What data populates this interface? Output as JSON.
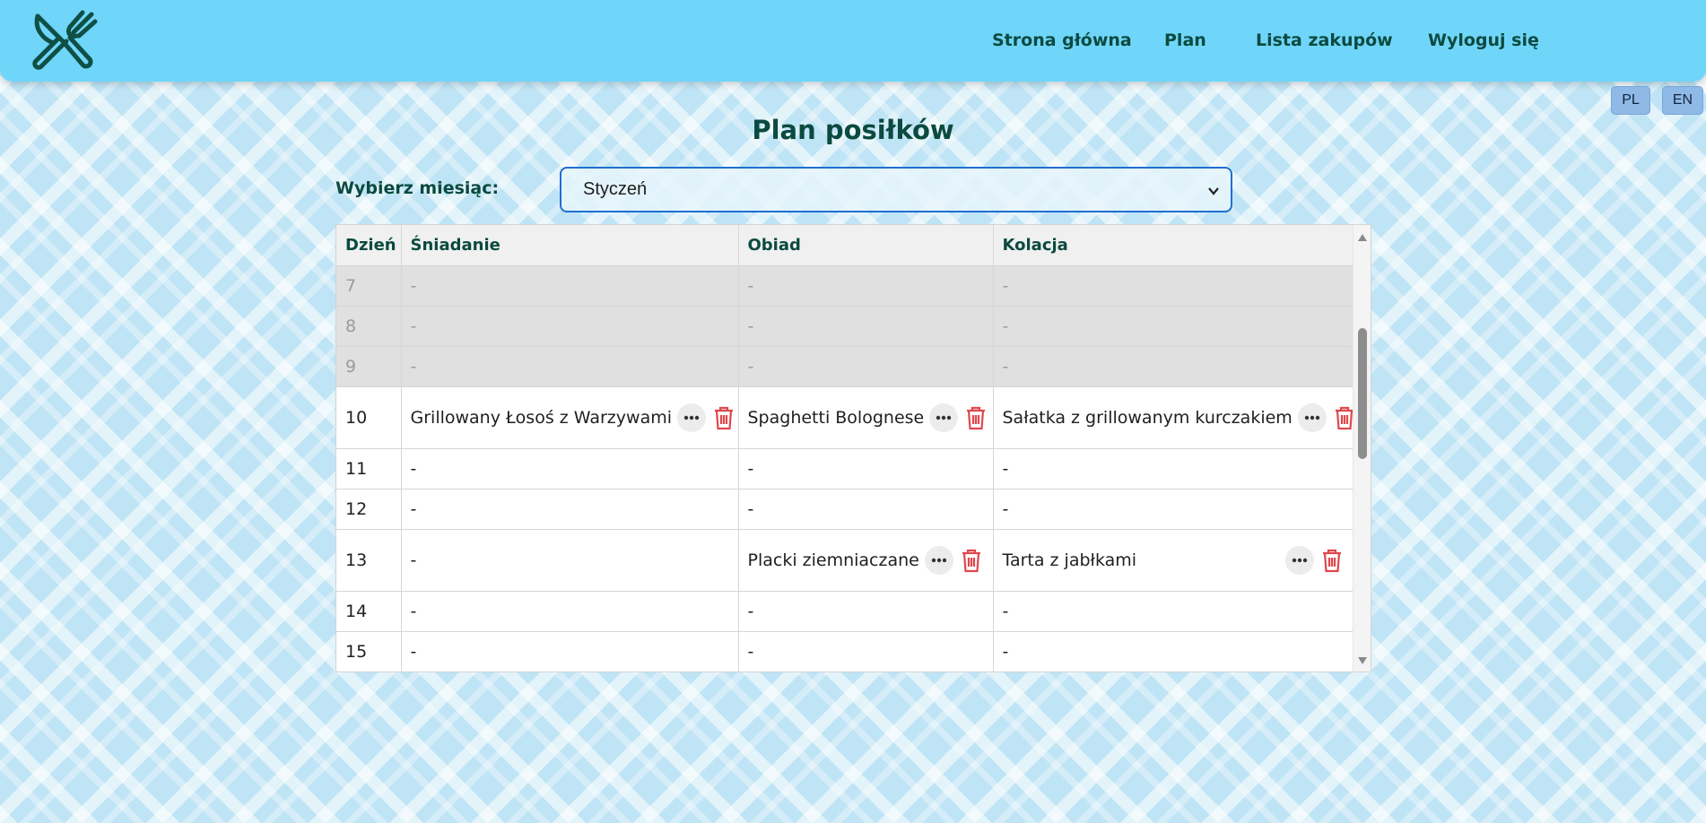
{
  "nav": {
    "logo_icon": "fork-knife-icon",
    "links": [
      "Strona główna",
      "Plan",
      "Lista zakupów",
      "Wyloguj się"
    ]
  },
  "lang": {
    "pl": "PL",
    "en": "EN"
  },
  "page": {
    "title": "Plan posiłków"
  },
  "month": {
    "label": "Wybierz miesiąc:",
    "selected": "Styczeń"
  },
  "table": {
    "headers": [
      "Dzień",
      "Śniadanie",
      "Obiad",
      "Kolacja"
    ],
    "rows": [
      {
        "day": "7",
        "breakfast": "-",
        "lunch": "-",
        "dinner": "-"
      },
      {
        "day": "8",
        "breakfast": "-",
        "lunch": "-",
        "dinner": "-"
      },
      {
        "day": "9",
        "breakfast": "-",
        "lunch": "-",
        "dinner": "-"
      },
      {
        "day": "10",
        "breakfast": "Grillowany Łosoś z Warzywami",
        "lunch": "Spaghetti Bolognese",
        "dinner": "Sałatka z grillowanym kurczakiem"
      },
      {
        "day": "11",
        "breakfast": "-",
        "lunch": "-",
        "dinner": "-"
      },
      {
        "day": "12",
        "breakfast": "-",
        "lunch": "-",
        "dinner": "-"
      },
      {
        "day": "13",
        "breakfast": "-",
        "lunch": "Placki ziemniaczane",
        "dinner": "Tarta z jabłkami"
      },
      {
        "day": "14",
        "breakfast": "-",
        "lunch": "-",
        "dinner": "-"
      },
      {
        "day": "15",
        "breakfast": "-",
        "lunch": "-",
        "dinner": "-"
      }
    ]
  },
  "colors": {
    "navbar": "#6fd6fa",
    "heading": "#0b4a3f",
    "delete": "#e0474c",
    "select_border": "#1f6fd1"
  }
}
